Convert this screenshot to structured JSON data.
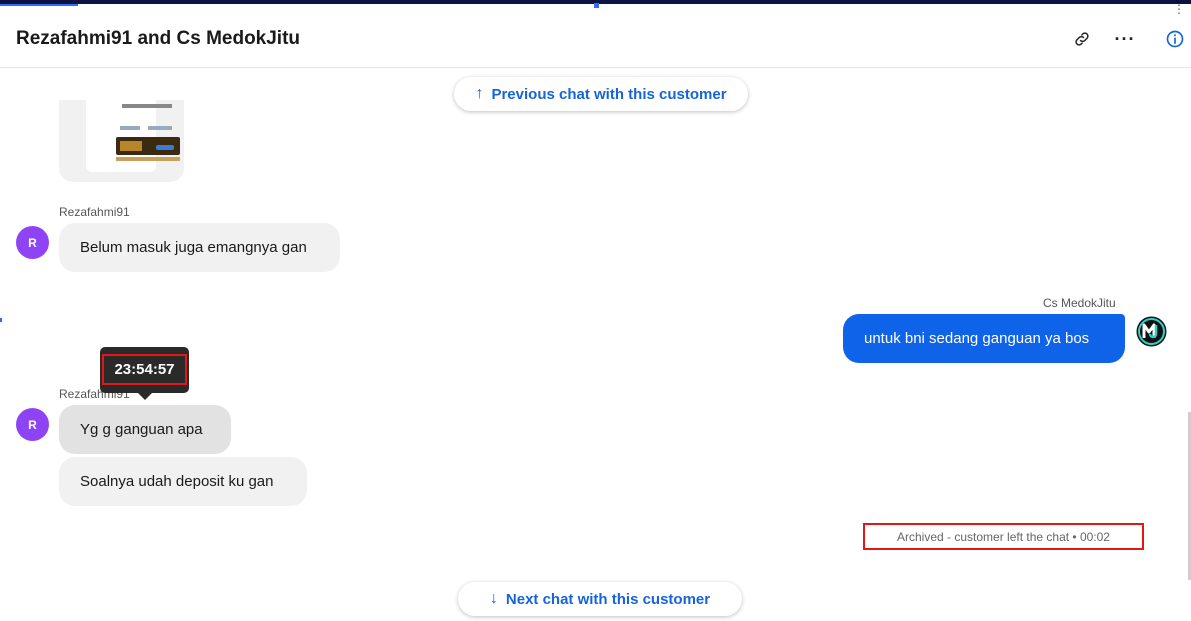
{
  "header": {
    "title": "Rezafahmi91 and Cs MedokJitu",
    "icons": {
      "link": "link-icon",
      "more": "more-icon",
      "info": "info-icon"
    }
  },
  "nav": {
    "prev_label": "Previous chat with this customer",
    "next_label": "Next chat with this customer"
  },
  "messages": [
    {
      "sender": "Rezafahmi91",
      "avatar": "R",
      "text": "Belum masuk juga emangnya gan"
    },
    {
      "sender": "Cs MedokJitu",
      "text": "untuk bni sedang ganguan ya bos"
    },
    {
      "sender": "Rezafahmi91",
      "avatar": "R",
      "text": "Yg g ganguan apa"
    },
    {
      "text": "Soalnya udah deposit ku gan"
    }
  ],
  "tooltip": {
    "time": "23:54:57"
  },
  "status": {
    "text": "Archived - customer left the chat • 00:02"
  },
  "colors": {
    "accent": "#1565d8",
    "agent_bubble": "#0e63e8",
    "avatar": "#8e44f5",
    "highlight": "#e01818"
  }
}
